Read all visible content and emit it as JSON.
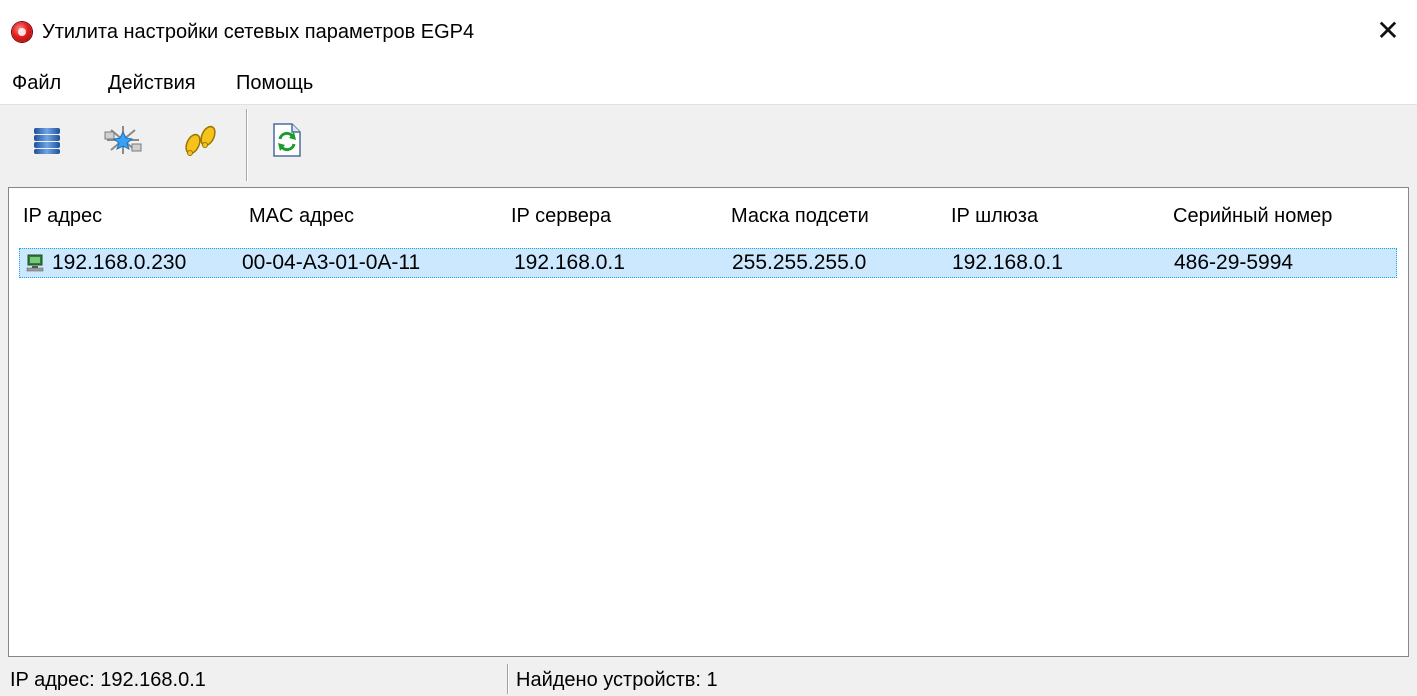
{
  "window": {
    "title": "Утилита настройки сетевых параметров EGP4",
    "close_glyph": "✕"
  },
  "menu": {
    "items": [
      "Файл",
      "Действия",
      "Помощь"
    ]
  },
  "toolbar": {
    "icons": [
      "database-icon",
      "network-search-icon",
      "footsteps-icon",
      "refresh-icon"
    ]
  },
  "table": {
    "headers": [
      "IP адрес",
      "MAC адрес",
      "IP сервера",
      "Маска подсети",
      "IP шлюза",
      "Серийный номер"
    ],
    "rows": [
      [
        "192.168.0.230",
        "00-04-A3-01-0A-11",
        "192.168.0.1",
        "255.255.255.0",
        "192.168.0.1",
        "486-29-5994"
      ]
    ]
  },
  "status": {
    "ip": "IP адрес: 192.168.0.1",
    "found": "Найдено устройств: 1"
  },
  "colors": {
    "selection": "#cce8ff",
    "selection_border": "#26a0da",
    "chrome": "#f0f0f0"
  }
}
